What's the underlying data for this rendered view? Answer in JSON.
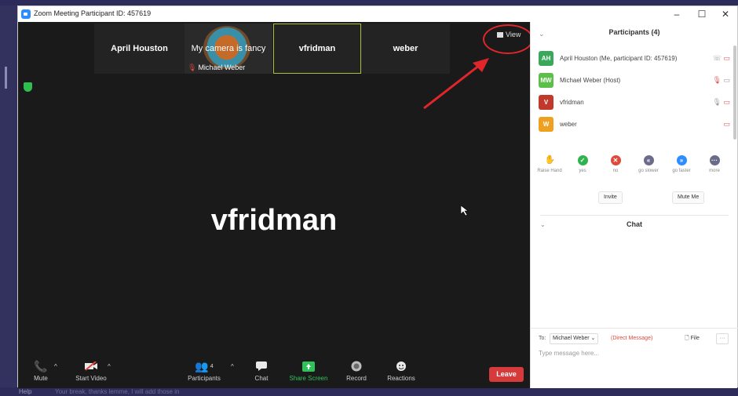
{
  "window": {
    "title": "Zoom Meeting Participant ID: 457619"
  },
  "video": {
    "thumbnails": [
      {
        "label": "April Houston"
      },
      {
        "caption": "My camera is fancy",
        "name": "Michael Weber"
      },
      {
        "label": "vfridman"
      },
      {
        "label": "weber"
      }
    ],
    "view_label": "View",
    "active_speaker": "vfridman"
  },
  "toolbar": {
    "mute": "Mute",
    "start_video": "Start Video",
    "participants": "Participants",
    "participants_count": "4",
    "chat": "Chat",
    "share_screen": "Share Screen",
    "record": "Record",
    "reactions": "Reactions",
    "leave": "Leave"
  },
  "participants_panel": {
    "title": "Participants (4)",
    "participants": [
      {
        "initials": "AH",
        "name": "April Houston (Me, participant ID: 457619)",
        "color": "#3aa85a"
      },
      {
        "initials": "MW",
        "name": "Michael Weber (Host)",
        "color": "#5bbf4a"
      },
      {
        "initials": "V",
        "name": "vfridman",
        "color": "#c0392b"
      },
      {
        "initials": "W",
        "name": "weber",
        "color": "#f0a020"
      }
    ],
    "reactions": [
      {
        "label": "Raise Hand",
        "color": "#2d8cff"
      },
      {
        "label": "yes",
        "color": "#2fb34f"
      },
      {
        "label": "no",
        "color": "#e0483c"
      },
      {
        "label": "go slower",
        "color": "#6b6b8a"
      },
      {
        "label": "go faster",
        "color": "#2d8cff"
      },
      {
        "label": "more",
        "color": "#6b6b8a"
      }
    ],
    "invite": "Invite",
    "mute_me": "Mute Me"
  },
  "chat": {
    "title": "Chat",
    "to_label": "To:",
    "recipient": "Michael Weber",
    "direct_message": "(Direct Message)",
    "file_label": "File",
    "more_label": "···",
    "placeholder": "Type message here..."
  },
  "background": {
    "help_label": "Help",
    "ghost_text": "Your break, thanks lemme, I will add those in"
  }
}
